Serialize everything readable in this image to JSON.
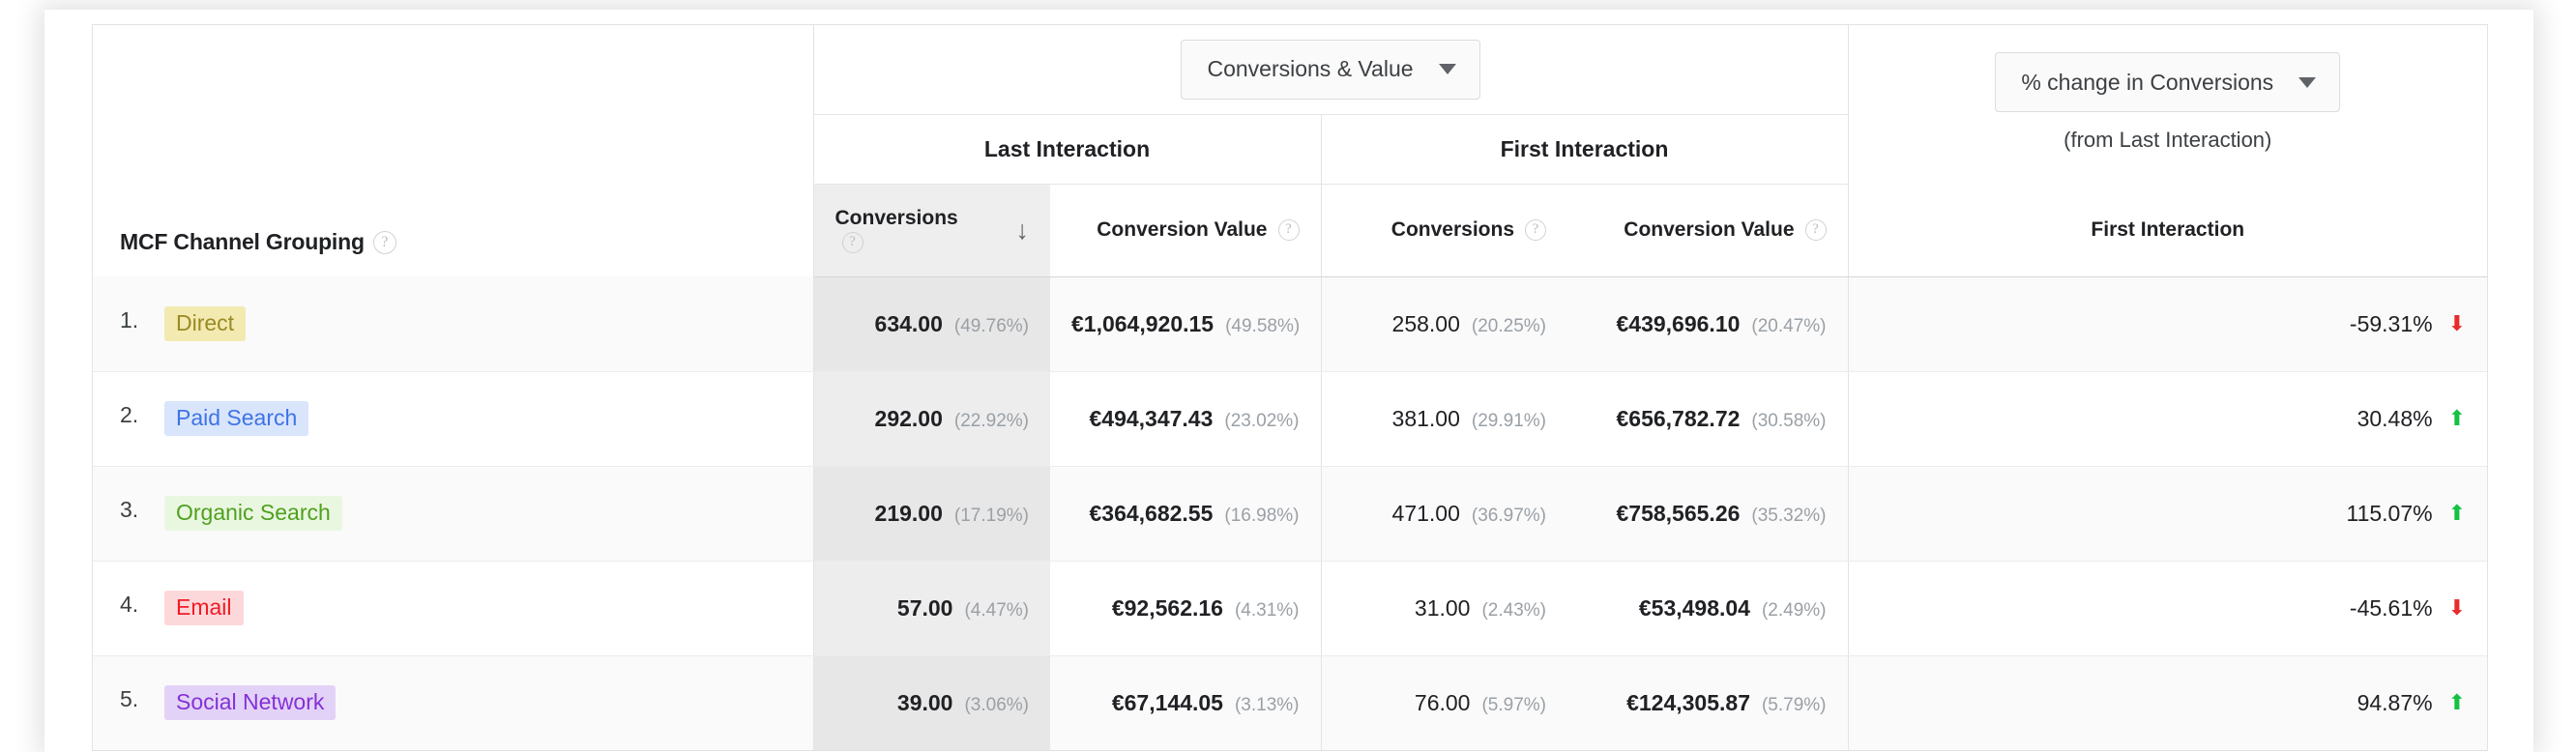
{
  "table": {
    "dimension_header": "MCF Channel Grouping",
    "help_glyph": "?",
    "metric_selector": {
      "label": "Conversions & Value",
      "caret": "caret-down"
    },
    "change_selector": {
      "label": "% change in Conversions",
      "caret": "caret-down",
      "sub_label": "(from Last Interaction)"
    },
    "groups": [
      {
        "label": "Last Interaction"
      },
      {
        "label": "First Interaction"
      }
    ],
    "change_column_header": "First Interaction",
    "columns": [
      {
        "label": "Conversions",
        "help": "?",
        "sorted": true,
        "sort_glyph": "↓"
      },
      {
        "label": "Conversion Value",
        "help": "?",
        "sorted": false
      },
      {
        "label": "Conversions",
        "help": "?",
        "sorted": false
      },
      {
        "label": "Conversion Value",
        "help": "?",
        "sorted": false
      }
    ],
    "rows": [
      {
        "rank": "1.",
        "channel": "Direct",
        "chip_bg": "#f2eab0",
        "chip_fg": "#9a8a24",
        "last_conversions": "634.00",
        "last_conversions_pct": "(49.76%)",
        "last_value": "€1,064,920.15",
        "last_value_pct": "(49.58%)",
        "first_conversions": "258.00",
        "first_conversions_pct": "(20.25%)",
        "first_value": "€439,696.10",
        "first_value_pct": "(20.47%)",
        "change": "-59.31%",
        "change_dir": "down",
        "change_glyph": "⬇"
      },
      {
        "rank": "2.",
        "channel": "Paid Search",
        "chip_bg": "#d8e5fb",
        "chip_fg": "#3f72e8",
        "last_conversions": "292.00",
        "last_conversions_pct": "(22.92%)",
        "last_value": "€494,347.43",
        "last_value_pct": "(23.02%)",
        "first_conversions": "381.00",
        "first_conversions_pct": "(29.91%)",
        "first_value": "€656,782.72",
        "first_value_pct": "(30.58%)",
        "change": "30.48%",
        "change_dir": "up",
        "change_glyph": "⬆"
      },
      {
        "rank": "3.",
        "channel": "Organic Search",
        "chip_bg": "#eaf7e0",
        "chip_fg": "#4fa01f",
        "last_conversions": "219.00",
        "last_conversions_pct": "(17.19%)",
        "last_value": "€364,682.55",
        "last_value_pct": "(16.98%)",
        "first_conversions": "471.00",
        "first_conversions_pct": "(36.97%)",
        "first_value": "€758,565.26",
        "first_value_pct": "(35.32%)",
        "change": "115.07%",
        "change_dir": "up",
        "change_glyph": "⬆"
      },
      {
        "rank": "4.",
        "channel": "Email",
        "chip_bg": "#fdd8da",
        "chip_fg": "#f01c25",
        "last_conversions": "57.00",
        "last_conversions_pct": "(4.47%)",
        "last_value": "€92,562.16",
        "last_value_pct": "(4.31%)",
        "first_conversions": "31.00",
        "first_conversions_pct": "(2.43%)",
        "first_value": "€53,498.04",
        "first_value_pct": "(2.49%)",
        "change": "-45.61%",
        "change_dir": "down",
        "change_glyph": "⬇"
      },
      {
        "rank": "5.",
        "channel": "Social Network",
        "chip_bg": "#e3d2f7",
        "chip_fg": "#8430d6",
        "last_conversions": "39.00",
        "last_conversions_pct": "(3.06%)",
        "last_value": "€67,144.05",
        "last_value_pct": "(3.13%)",
        "first_conversions": "76.00",
        "first_conversions_pct": "(5.97%)",
        "first_value": "€124,305.87",
        "first_value_pct": "(5.79%)",
        "change": "94.87%",
        "change_dir": "up",
        "change_glyph": "⬆"
      }
    ]
  },
  "colors": {
    "positive": "#16c143",
    "negative": "#ea2b2b",
    "muted": "#9aa0a6",
    "text": "#202124"
  }
}
